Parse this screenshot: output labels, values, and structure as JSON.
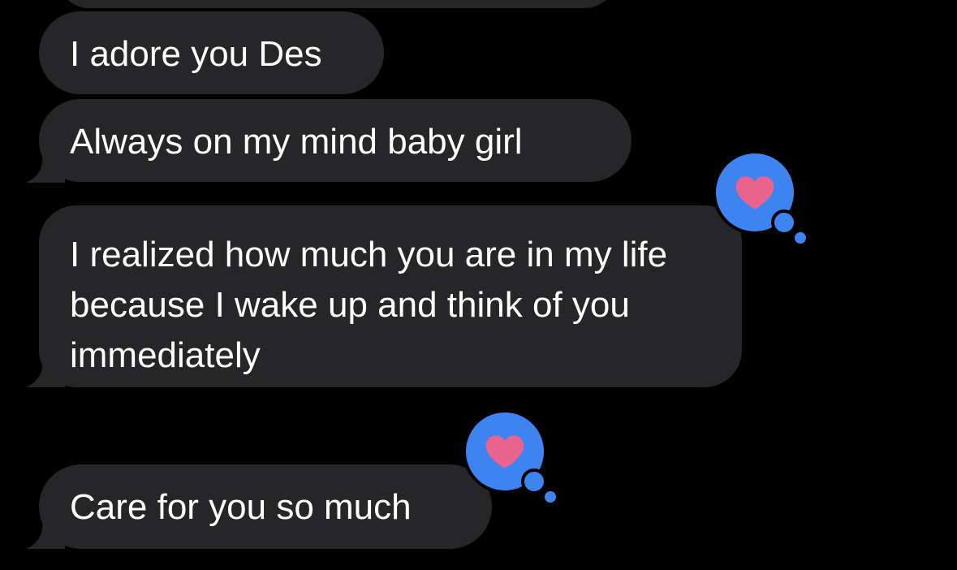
{
  "conversation": {
    "messages": [
      {
        "text": "I adore you Des",
        "tail": false,
        "reaction": null
      },
      {
        "text": "Always on my mind baby girl",
        "tail": true,
        "reaction": null
      },
      {
        "text": "I realized how much you are in my life because I wake up and think of you immediately",
        "tail": true,
        "reaction": "heart-icon"
      },
      {
        "text": "Care for you so much",
        "tail": true,
        "reaction": "heart-icon"
      }
    ]
  },
  "colors": {
    "background": "#000000",
    "incoming_bubble": "#262628",
    "message_text": "#ffffff",
    "reaction_bubble": "#3d84f0",
    "heart": "#e9638f"
  }
}
